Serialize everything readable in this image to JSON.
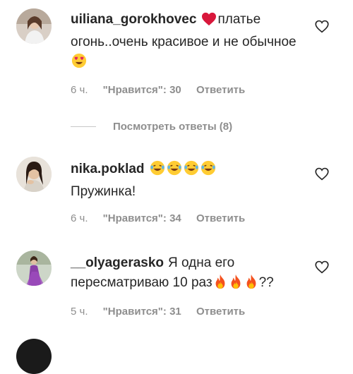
{
  "comments": [
    {
      "username": "uiliana_gorokhovec",
      "text_emoji": "heart",
      "text": "платье огонь..очень красивое и не обычное",
      "trailing_emoji": "heart-eyes",
      "time": "6 ч.",
      "likes": "\"Нравится\": 30",
      "reply": "Ответить"
    },
    {
      "username": "nika.poklad",
      "text_emoji": "laughing-tears",
      "text": "Пружинка!",
      "time": "6 ч.",
      "likes": "\"Нравится\": 34",
      "reply": "Ответить"
    },
    {
      "username": "__olyagerasko",
      "text": "Я одна его пересматриваю 10 раз",
      "trailing_emoji": "fire",
      "trailing_text": "??",
      "time": "5 ч.",
      "likes": "\"Нравится\": 31",
      "reply": "Ответить"
    }
  ],
  "view_replies": "Посмотреть ответы (8)",
  "colors": {
    "text": "#262626",
    "meta": "#8e8e8e",
    "heart_red": "#e0245e",
    "emoji_yellow": "#ffcc33"
  },
  "icons": [
    "like-heart-icon",
    "heart-emoji",
    "heart-eyes-emoji",
    "laughing-tears-emoji",
    "fire-emoji"
  ]
}
